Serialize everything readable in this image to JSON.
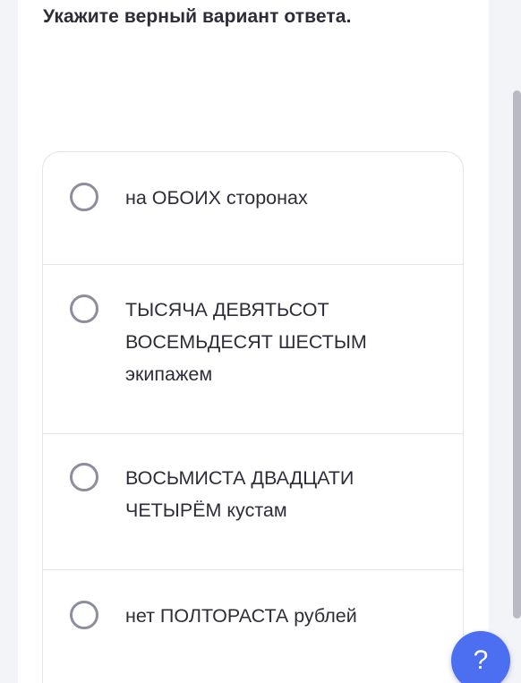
{
  "question": {
    "title": "Укажите верный вариант ответа."
  },
  "options": [
    {
      "text": "на ОБОИХ сторонах",
      "selected": false
    },
    {
      "text": "ТЫСЯЧА ДЕВЯТЬСОТ ВОСЕМЬДЕСЯТ ШЕСТЫМ экипажем",
      "selected": false
    },
    {
      "text": "ВОСЬМИСТА ДВАДЦАТИ ЧЕТЫРЁМ кустам",
      "selected": false
    },
    {
      "text": "нет ПОЛТОРАСТА рублей",
      "selected": false
    }
  ],
  "help": {
    "label": "?",
    "icon": "question-mark-icon",
    "color": "#4c6ef0"
  }
}
